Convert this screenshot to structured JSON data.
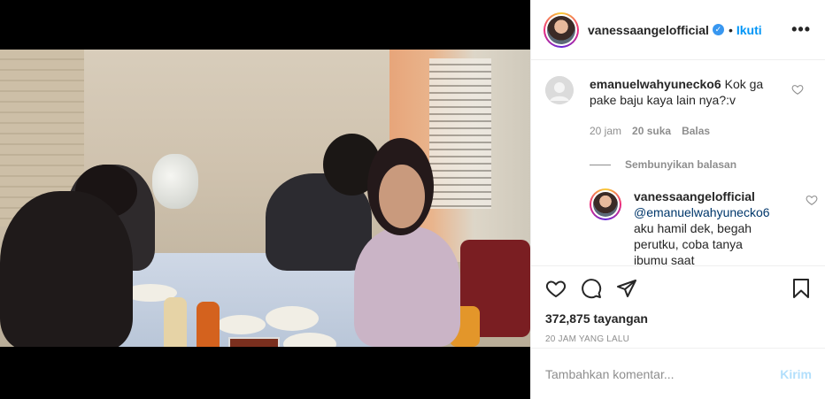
{
  "post": {
    "username": "vanessaangelofficial",
    "verified_icon": "verified-badge-icon",
    "separator": "•",
    "follow_label": "Ikuti",
    "more_label": "•••"
  },
  "comments": [
    {
      "username": "emanuelwahyunecko6",
      "text": "Kok ga pake baju kaya lain nya?:v",
      "time": "20 jam",
      "likes": "20 suka",
      "reply_label": "Balas"
    }
  ],
  "replies_toggle": "Sembunyikan balasan",
  "reply": {
    "username": "vanessaangelofficial",
    "mention": "@emanuelwahyunecko6",
    "text": "aku hamil dek, begah perutku, coba tanya ibumu saat"
  },
  "stats": {
    "views": "372,875 tayangan",
    "time_ago": "20 JAM YANG LALU"
  },
  "composer": {
    "placeholder": "Tambahkan komentar...",
    "post_label": "Kirim"
  },
  "colors": {
    "link_blue": "#0095f6",
    "verified_blue": "#3897f0",
    "muted": "#8e8e8e",
    "post_disabled": "#b2dffc"
  },
  "icons": [
    "heart-icon",
    "comment-icon",
    "share-icon",
    "bookmark-icon",
    "more-options-icon"
  ]
}
